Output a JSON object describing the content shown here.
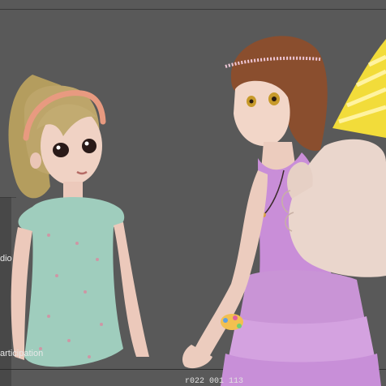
{
  "viewport": {
    "hud": {
      "left_label_1": "dio",
      "left_label_2": "articipation",
      "frame_readout": "r022 001 113"
    }
  },
  "colors": {
    "background": "#595959",
    "grid": "#3a3a3a",
    "hud_text": "#e8e8e8"
  },
  "icons": {
    "party_hat": "party-hat-icon"
  }
}
